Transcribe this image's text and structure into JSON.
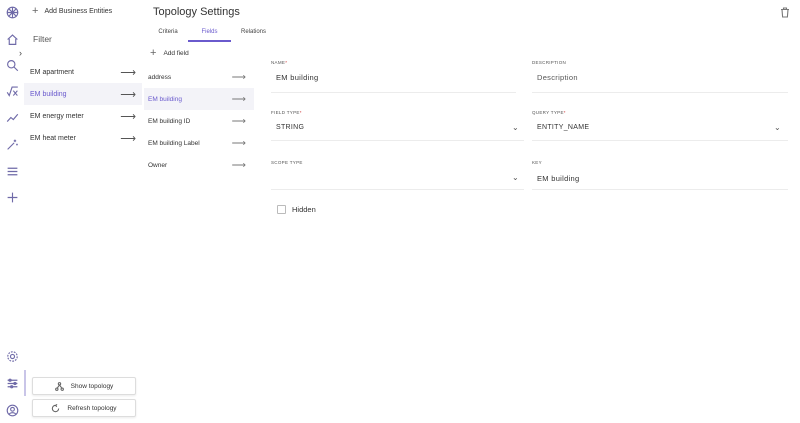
{
  "filter_panel": {
    "add_button_label": "Add Business Entities",
    "title": "Filter",
    "entities": [
      {
        "label": "EM apartment",
        "selected": false
      },
      {
        "label": "EM building",
        "selected": true
      },
      {
        "label": "EM energy meter",
        "selected": false
      },
      {
        "label": "EM heat meter",
        "selected": false
      }
    ],
    "show_topology_label": "Show topology",
    "refresh_topology_label": "Refresh topology"
  },
  "main": {
    "title": "Topology Settings",
    "tabs": [
      {
        "label": "Criteria",
        "active": false
      },
      {
        "label": "Fields",
        "active": true
      },
      {
        "label": "Relations",
        "active": false
      }
    ],
    "add_field_label": "Add field",
    "fields": [
      {
        "label": "address",
        "selected": false
      },
      {
        "label": "EM building",
        "selected": true
      },
      {
        "label": "EM building ID",
        "selected": false
      },
      {
        "label": "EM building Label",
        "selected": false
      },
      {
        "label": "Owner",
        "selected": false
      }
    ]
  },
  "form": {
    "name_label": "Name",
    "name_value": "EM building",
    "description_label": "Description",
    "description_value": "Description",
    "field_type_label": "Field Type",
    "field_type_value": "STRING",
    "query_type_label": "Query Type",
    "query_type_value": "ENTITY_NAME",
    "scope_type_label": "Scope Type",
    "scope_type_value": "",
    "key_label": "Key",
    "key_value": "EM building",
    "hidden_label": "Hidden",
    "hidden_checked": false,
    "required_marker": "*"
  },
  "icons": {
    "rail": [
      "logo-icon",
      "home-icon",
      "search-icon",
      "formula-icon",
      "chart-icon",
      "magic-icon",
      "menu-icon",
      "add-icon",
      "settings-icon",
      "filter-settings-icon",
      "user-icon"
    ]
  },
  "colors": {
    "accent": "#6a5acd",
    "selected_bg": "#f3f3f8",
    "rail_icon": "#6f6aa8"
  }
}
